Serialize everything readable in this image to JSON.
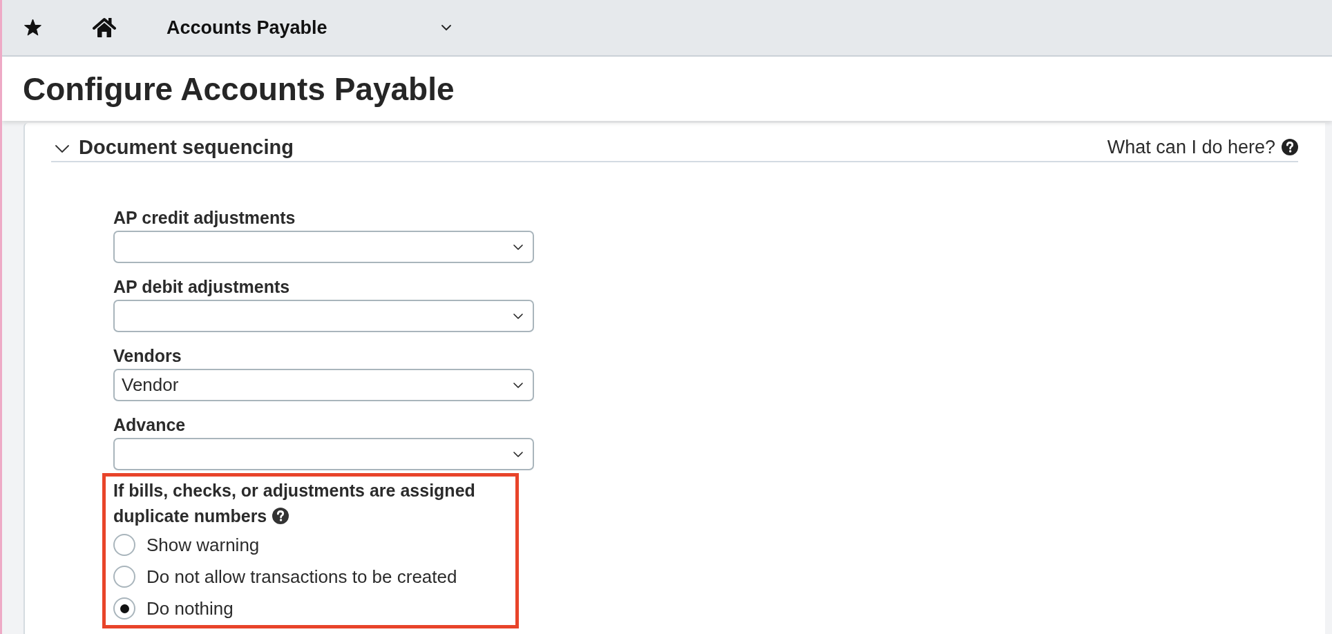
{
  "top_bar": {
    "module": "Accounts Payable"
  },
  "page": {
    "title": "Configure Accounts Payable"
  },
  "section": {
    "title": "Document sequencing",
    "expanded": true,
    "help_link": "What can I do here?"
  },
  "fields": [
    {
      "label": "AP credit adjustments"
    },
    {
      "label": "AP debit adjustments"
    },
    {
      "label": "Vendors",
      "value": "Vendor"
    },
    {
      "label": "Advance"
    }
  ],
  "duplicate_numbers": {
    "label": "If bills, checks, or adjustments are assigned duplicate numbers",
    "highlighted": true,
    "options": [
      {
        "label": "Show warning",
        "selected": false
      },
      {
        "label": "Do not allow transactions to be created",
        "selected": false
      },
      {
        "label": "Do nothing",
        "selected": true
      }
    ]
  }
}
